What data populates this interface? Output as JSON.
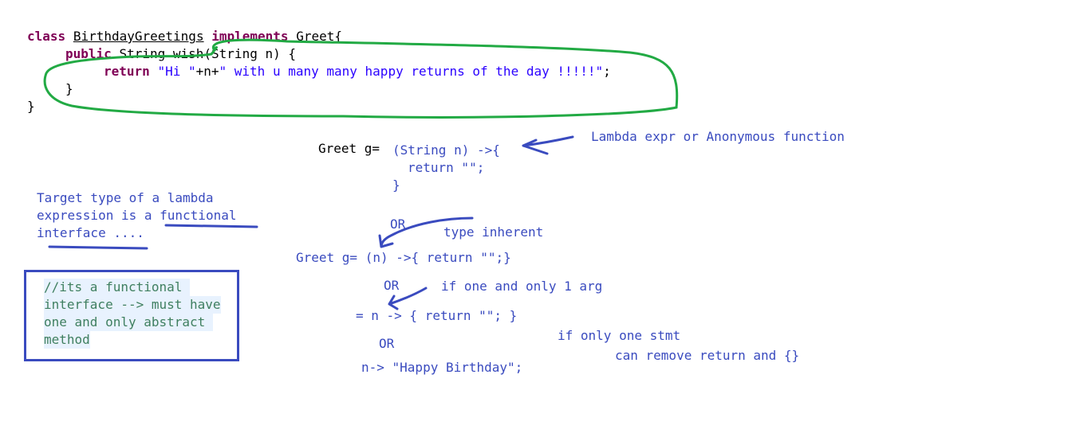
{
  "code": {
    "line1": {
      "kw": "class",
      "name": "BirthdayGreetings",
      "kw2": "implements",
      "rest": "Greet{"
    },
    "line2": {
      "kw": "public",
      "rest": "String wish(String n) {"
    },
    "line3": {
      "kw": "return",
      "str1": "\"Hi \"",
      "mid": "+n+",
      "str2": "\" with u many many happy returns of the day !!!!!\"",
      "end": ";"
    },
    "line4": "}",
    "line5": "}"
  },
  "notes": {
    "lambda_label": "Lambda expr or Anonymous function",
    "greet_decl": "Greet g=",
    "lambda_head": "(String n) ->{",
    "lambda_return": "return \"\";",
    "lambda_close": "}",
    "target_type": [
      "Target type of a lambda",
      "expression is a",
      "functional",
      "interface ...."
    ],
    "or1": "OR",
    "type_inherent": "type inherent",
    "greet_short": "Greet g= (n) ->{ return \"\";}",
    "or2": "OR",
    "one_arg": "if one and only 1 arg",
    "n_arrow": "= n -> { return \"\"; }",
    "or3": "OR",
    "one_stmt": "if only one stmt",
    "remove_return": "can remove return and {}",
    "final_lambda": "n-> \"Happy Birthday\";"
  },
  "comment": {
    "lines": [
      "//its a functional ",
      "interface --> must have",
      "one and only abstract ",
      "method"
    ]
  },
  "colors": {
    "keyword": "#7f0055",
    "string": "#2a00ff",
    "handwriting_blue": "#3a4bbf",
    "green_marker": "#22aa44",
    "comment_green": "#3f7f5f"
  }
}
